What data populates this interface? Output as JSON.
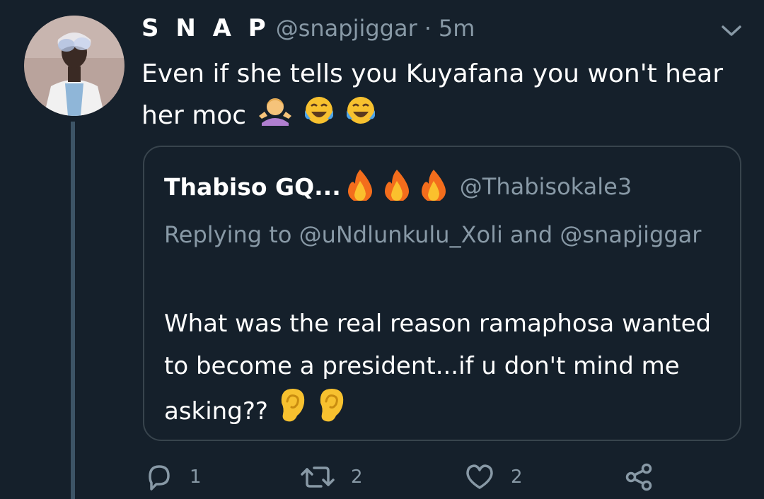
{
  "tweet": {
    "display_name": "S N A P",
    "handle": "@snapjiggar",
    "separator": "·",
    "time": "5m",
    "text": "Even if she tells you Kuyafana you won't hear her moc",
    "text_emojis": [
      "person-shrugging-emoji",
      "tears-of-joy-emoji",
      "tears-of-joy-emoji"
    ]
  },
  "quoted_tweet": {
    "display_name": "Thabiso GQ...",
    "name_emojis": [
      "fire-emoji",
      "fire-emoji",
      "fire-emoji"
    ],
    "handle": "@Thabisokale3",
    "replying_to": "Replying to @uNdlunkulu_Xoli and @snapjiggar",
    "text": "What was the real reason ramaphosa wanted to become a president...if u don't mind me asking??",
    "text_emojis": [
      "ear-emoji",
      "ear-emoji"
    ]
  },
  "actions": {
    "reply_count": "1",
    "retweet_count": "2",
    "like_count": "2"
  },
  "colors": {
    "background": "#15202b",
    "secondary_text": "#8899a6",
    "border": "#38444d"
  }
}
